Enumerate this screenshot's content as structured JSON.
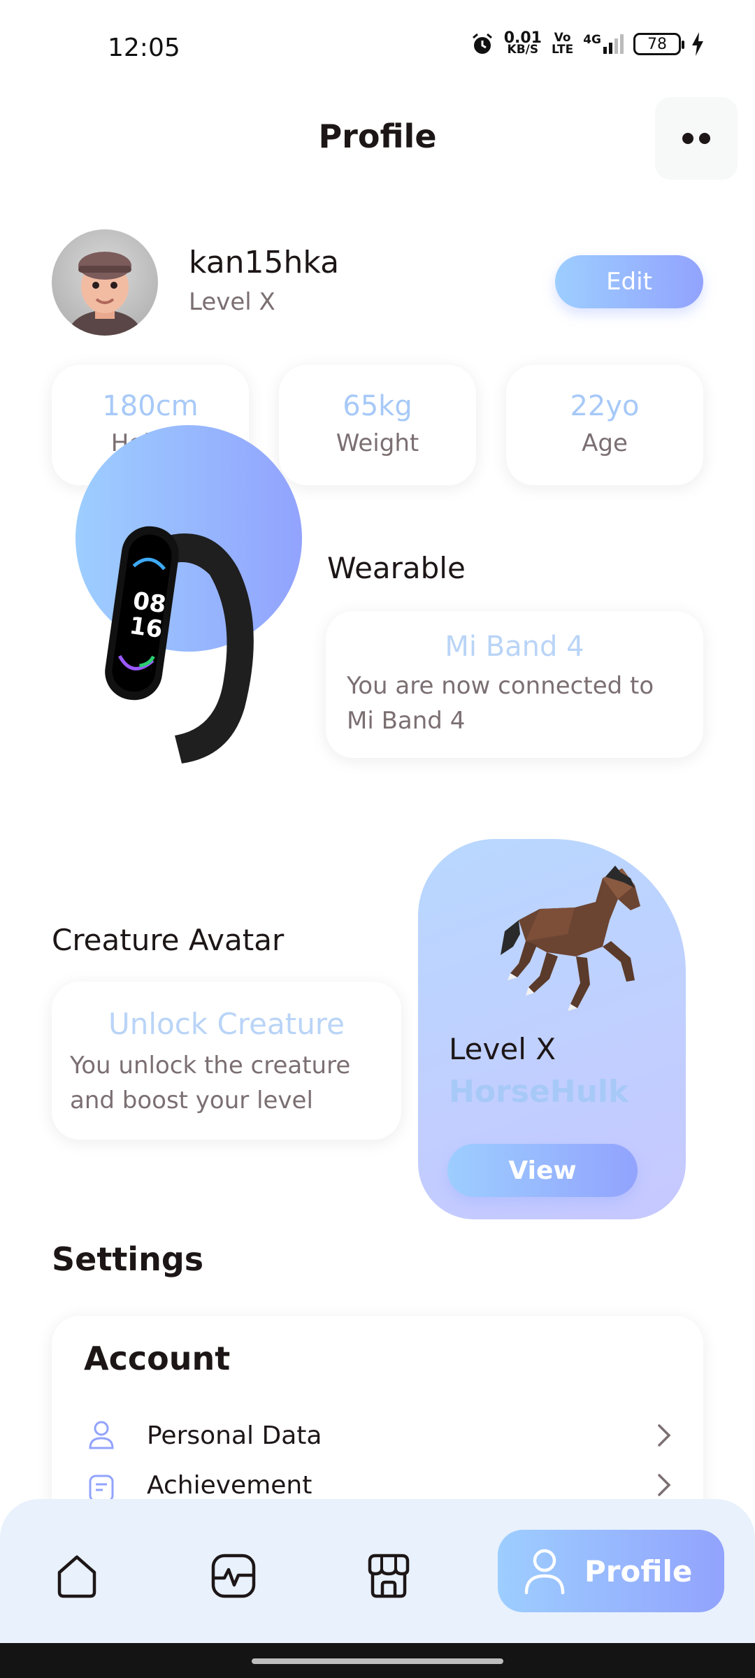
{
  "status_bar": {
    "time": "12:05",
    "net_speed_value": "0.01",
    "net_speed_unit": "KB/S",
    "volte_top": "Vo",
    "volte_bottom": "LTE",
    "network": "4G",
    "battery": "78"
  },
  "header": {
    "title": "Profile"
  },
  "profile": {
    "username": "kan15hka",
    "level": "Level X",
    "edit_label": "Edit"
  },
  "stats": [
    {
      "value": "180cm",
      "label": "Height"
    },
    {
      "value": "65kg",
      "label": "Weight"
    },
    {
      "value": "22yo",
      "label": "Age"
    }
  ],
  "wearable": {
    "title": "Wearable",
    "device": "Mi Band 4",
    "description": "You are now connected to Mi Band 4",
    "band_time_hours": "08",
    "band_time_minutes": "16"
  },
  "creature": {
    "title": "Creature Avatar",
    "unlock_title": "Unlock Creature",
    "unlock_description": "You unlock the creature and boost your level",
    "panel_level": "Level X",
    "panel_name": "HorseHulk",
    "view_label": "View"
  },
  "settings": {
    "title": "Settings",
    "account_title": "Account",
    "items": [
      {
        "label": "Personal Data",
        "icon": "person-icon"
      },
      {
        "label": "Achievement",
        "icon": "document-icon"
      }
    ]
  },
  "bottom_nav": {
    "items": [
      "home-icon",
      "activity-icon",
      "store-icon"
    ],
    "active_label": "Profile",
    "active_icon": "profile-icon"
  },
  "colors": {
    "accent_start": "#9DCEFF",
    "accent_end": "#92A3FD",
    "text_dark": "#1D1617",
    "text_gray": "#7B6F72",
    "nav_background": "#E8F1FC"
  }
}
